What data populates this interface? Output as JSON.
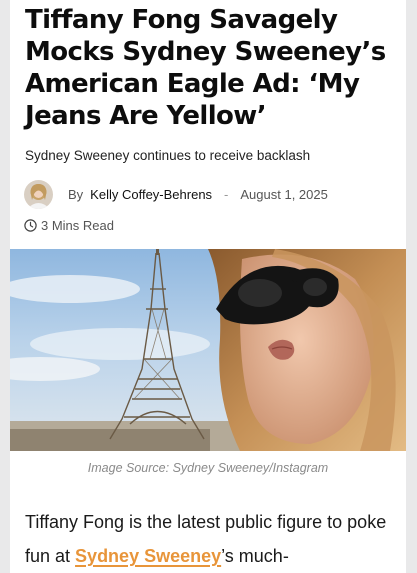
{
  "article": {
    "headline": "Tiffany Fong Savagely Mocks Sydney Sweeney’s American Eagle Ad: ‘My Jeans Are Yellow’",
    "subheadline": "Sydney Sweeney continues to receive backlash",
    "byline_prefix": "By",
    "author": "Kelly Coffey-Behrens",
    "separator": "-",
    "date": "August 1, 2025",
    "read_time": "3 Mins Read",
    "image_caption": "Image Source: Sydney Sweeney/Instagram",
    "body": {
      "text_before_link": "Tiffany Fong is the latest public figure to poke fun at ",
      "link_text": "Sydney Sweeney",
      "text_after_link": "’s much-"
    }
  },
  "icons": {
    "clock": "clock-icon"
  },
  "colors": {
    "link": "#e8953a",
    "headline": "#0d0d0d",
    "caption": "#8a8a8a",
    "background": "#e9e9ea"
  }
}
